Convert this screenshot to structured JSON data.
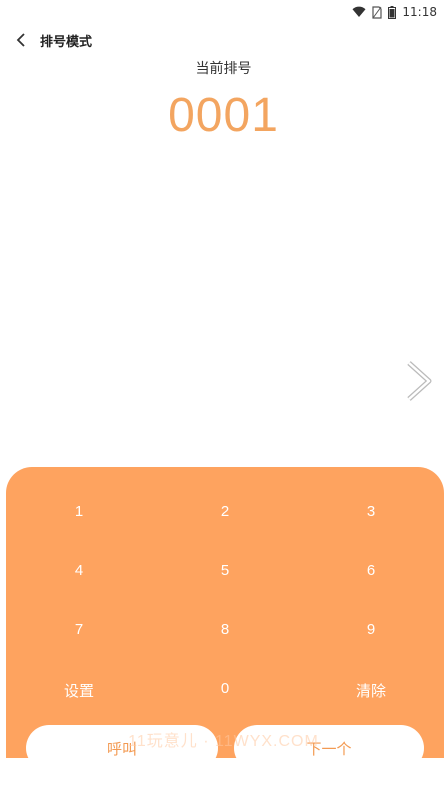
{
  "status_bar": {
    "time": "11:18",
    "icons": [
      "wifi-icon",
      "no-sim-icon",
      "battery-icon"
    ]
  },
  "header": {
    "back_icon": "chevron-left-icon",
    "title": "排号模式"
  },
  "current": {
    "label": "当前排号",
    "number": "0001"
  },
  "next_arrow_icon": "chevron-right-icon",
  "keypad": {
    "keys": [
      "1",
      "2",
      "3",
      "4",
      "5",
      "6",
      "7",
      "8",
      "9",
      "设置",
      "0",
      "清除"
    ]
  },
  "actions": {
    "call_label": "呼叫",
    "next_label": "下一个"
  },
  "watermark": "11玩意儿 · 11WYX.COM",
  "colors": {
    "accent": "#f3a560",
    "panel": "#fea35f",
    "panel_text": "#ffffff"
  }
}
